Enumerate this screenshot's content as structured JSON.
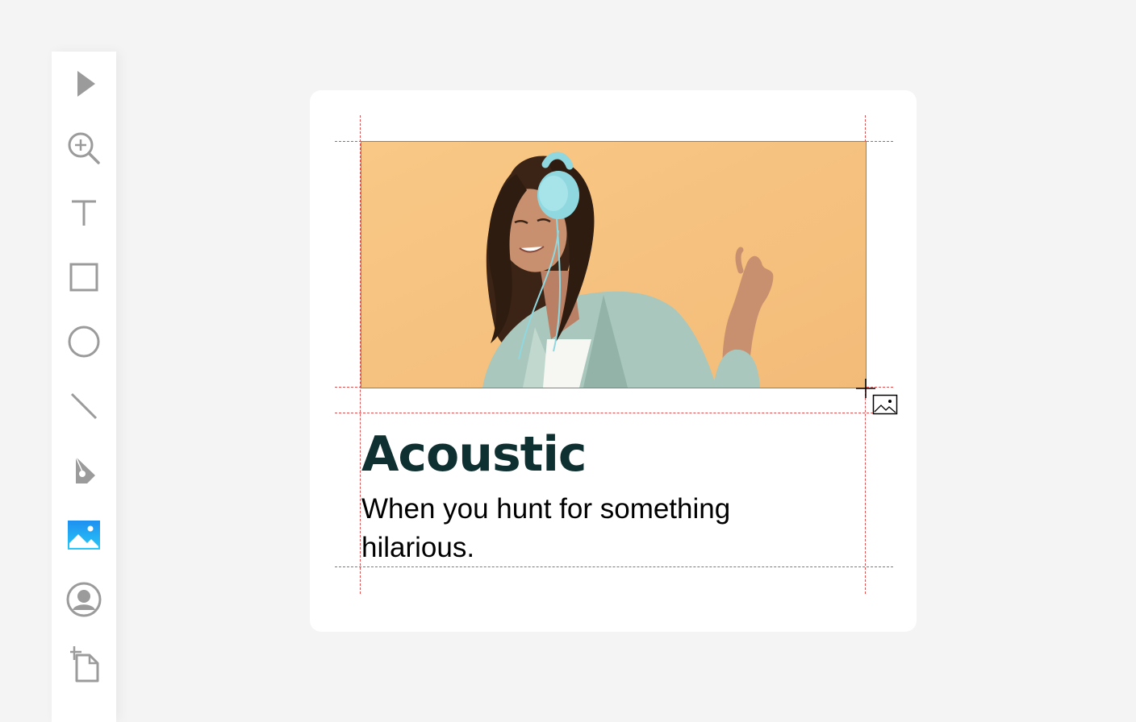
{
  "toolbar": {
    "tools": [
      {
        "name": "select-tool",
        "icon": "pointer-icon",
        "active": false
      },
      {
        "name": "zoom-tool",
        "icon": "zoom-in-icon",
        "active": false
      },
      {
        "name": "text-tool",
        "icon": "text-icon",
        "active": false
      },
      {
        "name": "rectangle-tool",
        "icon": "square-icon",
        "active": false
      },
      {
        "name": "ellipse-tool",
        "icon": "circle-icon",
        "active": false
      },
      {
        "name": "line-tool",
        "icon": "line-icon",
        "active": false
      },
      {
        "name": "pen-tool",
        "icon": "pen-nib-icon",
        "active": false
      },
      {
        "name": "image-tool",
        "icon": "image-icon",
        "active": true
      },
      {
        "name": "avatar-tool",
        "icon": "user-circle-icon",
        "active": false
      },
      {
        "name": "artboard-tool",
        "icon": "artboard-icon",
        "active": false
      }
    ],
    "icon_color": "#9b9b9b",
    "active_color": "#1ea7f5"
  },
  "card": {
    "title": "Acoustic",
    "description": "When you hunt for something hilarious.",
    "title_color": "#0f3030",
    "image_subject": "woman-with-headphones-photo",
    "image_background": "#f6c07e"
  },
  "canvas": {
    "guide_color": "#e05050",
    "selection_color": "#4a90e2",
    "cursor": "crosshair-image-cursor"
  }
}
